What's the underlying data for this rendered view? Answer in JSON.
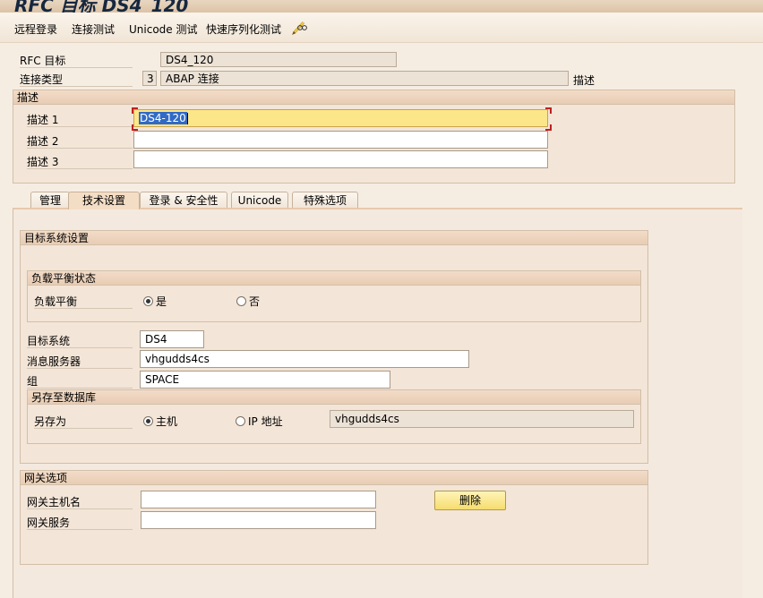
{
  "window": {
    "title": "RFC 目标 DS4_120"
  },
  "toolbar": {
    "items": [
      "远程登录",
      "连接测试",
      "Unicode 测试",
      "快速序列化测试"
    ],
    "edit_icon": "pencil-glasses-icon"
  },
  "header": {
    "rfc_target_label": "RFC 目标",
    "rfc_target_value": "DS4_120",
    "conn_type_label": "连接类型",
    "conn_type_code": "3",
    "conn_type_value": "ABAP 连接",
    "conn_type_desc": "描述"
  },
  "description": {
    "title": "描述",
    "fields": [
      {
        "label": "描述 1",
        "value": "DS4-120"
      },
      {
        "label": "描述 2",
        "value": ""
      },
      {
        "label": "描述 3",
        "value": ""
      }
    ]
  },
  "tabs": [
    {
      "label": "管理",
      "active": false
    },
    {
      "label": "技术设置",
      "active": true
    },
    {
      "label": "登录 & 安全性",
      "active": false
    },
    {
      "label": "Unicode",
      "active": false
    },
    {
      "label": "特殊选项",
      "active": false
    }
  ],
  "target_system": {
    "title": "目标系统设置",
    "load_balance": {
      "title": "负载平衡状态",
      "label": "负载平衡",
      "options": [
        "是",
        "否"
      ],
      "selected": "是"
    },
    "target_system_label": "目标系统",
    "target_system_value": "DS4",
    "message_server_label": "消息服务器",
    "message_server_value": "vhgudds4cs",
    "group_label": "组",
    "group_value": "SPACE",
    "save_db": {
      "title": "另存至数据库",
      "label": "另存为",
      "options": [
        "主机",
        "IP 地址"
      ],
      "selected": "主机",
      "value": "vhgudds4cs"
    }
  },
  "gateway": {
    "title": "网关选项",
    "host_label": "网关主机名",
    "host_value": "",
    "service_label": "网关服务",
    "service_value": "",
    "delete_button": "删除"
  },
  "colors": {
    "background": "#f6ede2",
    "selection": "#316ac5",
    "focus_field": "#fce68a",
    "title_text": "#16273f"
  }
}
